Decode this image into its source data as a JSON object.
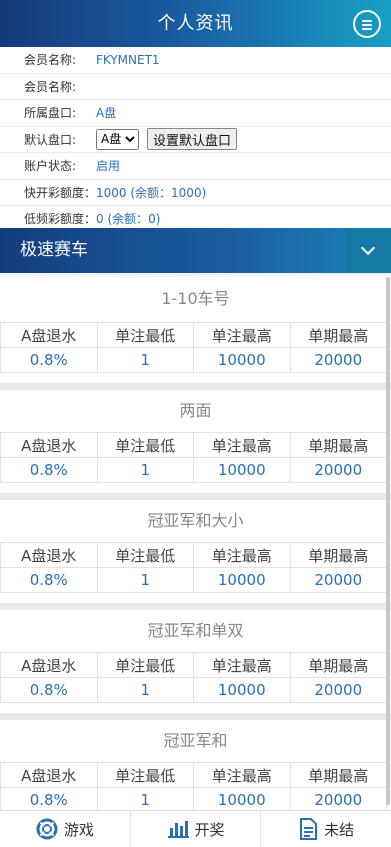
{
  "header": {
    "title": "个人资讯",
    "menu_icon": "menu-icon"
  },
  "account": {
    "member_name_label": "会员名称:",
    "member_name_value": "FKYMNET1",
    "member_name2_label": "会员名称:",
    "member_name2_value": "",
    "plate_label": "所属盘口:",
    "plate_value": "A盘",
    "default_plate_label": "默认盘口:",
    "default_plate_selected": "A盘",
    "set_default_button": "设置默认盘口",
    "status_label": "账户状态:",
    "status_value": "启用",
    "fast_quota_label": "快开彩额度：",
    "fast_quota_value": "1000 (余额：1000)",
    "low_quota_label": "低频彩额度：",
    "low_quota_value": "0 (余额：0)"
  },
  "game": {
    "title": "极速赛车",
    "toggle_icon": "chevron-down-icon"
  },
  "table_headers": [
    "A盘退水",
    "单注最低",
    "单注最高",
    "单期最高"
  ],
  "blocks": [
    {
      "name": "1-10车号",
      "values": [
        "0.8%",
        "1",
        "10000",
        "20000"
      ]
    },
    {
      "name": "两面",
      "values": [
        "0.8%",
        "1",
        "10000",
        "20000"
      ]
    },
    {
      "name": "冠亚军和大小",
      "values": [
        "0.8%",
        "1",
        "10000",
        "20000"
      ]
    },
    {
      "name": "冠亚军和单双",
      "values": [
        "0.8%",
        "1",
        "10000",
        "20000"
      ]
    },
    {
      "name": "冠亚军和",
      "values": [
        "0.8%",
        "1",
        "10000",
        "20000"
      ]
    }
  ],
  "nav": [
    {
      "label": "游戏",
      "icon": "lifebuoy-icon"
    },
    {
      "label": "开奖",
      "icon": "bar-chart-icon"
    },
    {
      "label": "未结",
      "icon": "document-icon"
    }
  ],
  "colors": {
    "accent": "#2a6fb8",
    "header_dark": "#163a7a",
    "header_light": "#17a0c6"
  }
}
